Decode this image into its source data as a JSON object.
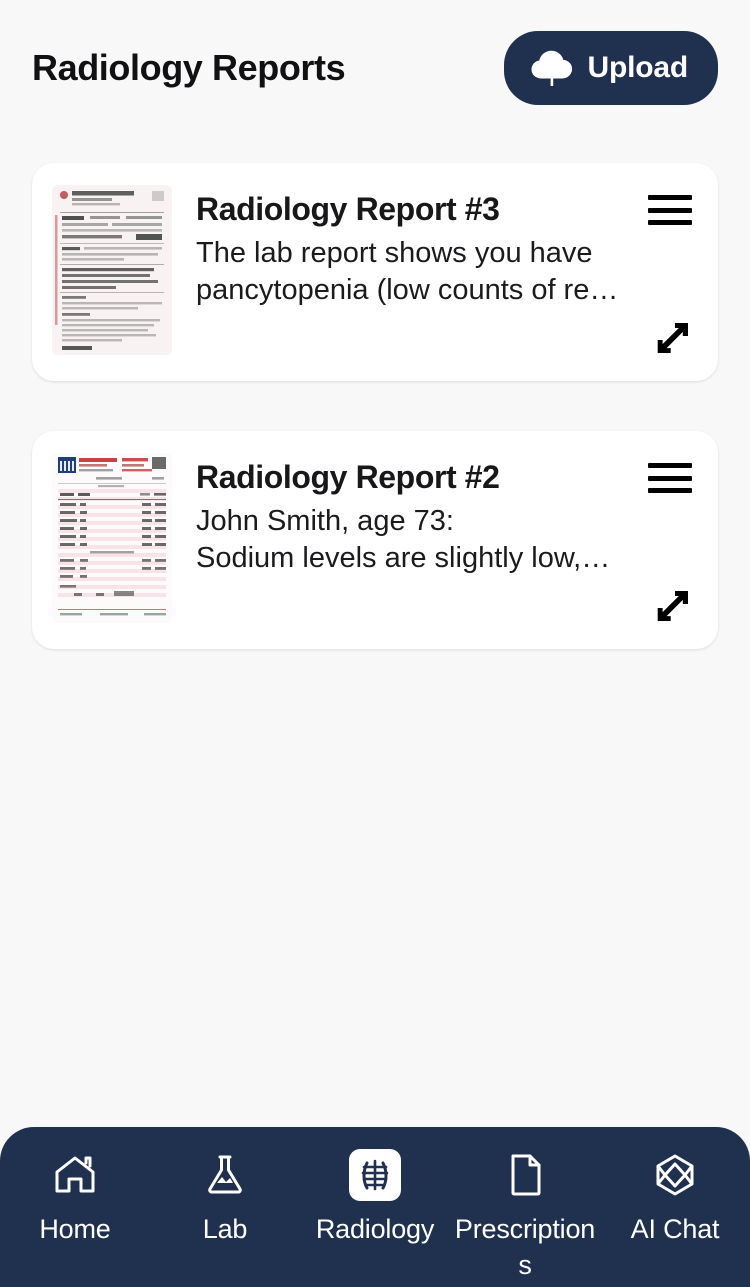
{
  "header": {
    "title": "Radiology Reports",
    "upload_label": "Upload",
    "upload_icon": "cloud-upload-icon",
    "accent_color": "#20304f"
  },
  "theme": {
    "page_background": "#f8f8f9",
    "outer_background": "#e9eff9",
    "card_background": "#ffffff",
    "nav_background": "#20304f",
    "text_primary": "#18181b",
    "nav_text": "#ffffff"
  },
  "reports": [
    {
      "title": "Radiology Report #3",
      "snippet": "The lab report shows you have\npancytopenia (low counts of re…",
      "thumbnail": "scanned-hospital-report-thumbnail",
      "menu_icon": "hamburger-menu-icon",
      "expand_icon": "expand-arrows-icon"
    },
    {
      "title": "Radiology Report #2",
      "snippet": "John Smith, age 73:\nSodium levels are slightly low,…",
      "thumbnail": "scanned-lab-results-thumbnail",
      "menu_icon": "hamburger-menu-icon",
      "expand_icon": "expand-arrows-icon"
    }
  ],
  "bottom_nav": {
    "active_index": 2,
    "items": [
      {
        "label": "Home",
        "icon": "home-icon",
        "active": false
      },
      {
        "label": "Lab",
        "icon": "flask-icon",
        "active": false
      },
      {
        "label": "Radiology",
        "icon": "lungs-xray-icon",
        "active": true
      },
      {
        "label": "Prescriptions",
        "icon": "document-icon",
        "active": false
      },
      {
        "label": "AI Chat",
        "icon": "cube-hexagon-icon",
        "active": false
      }
    ]
  }
}
